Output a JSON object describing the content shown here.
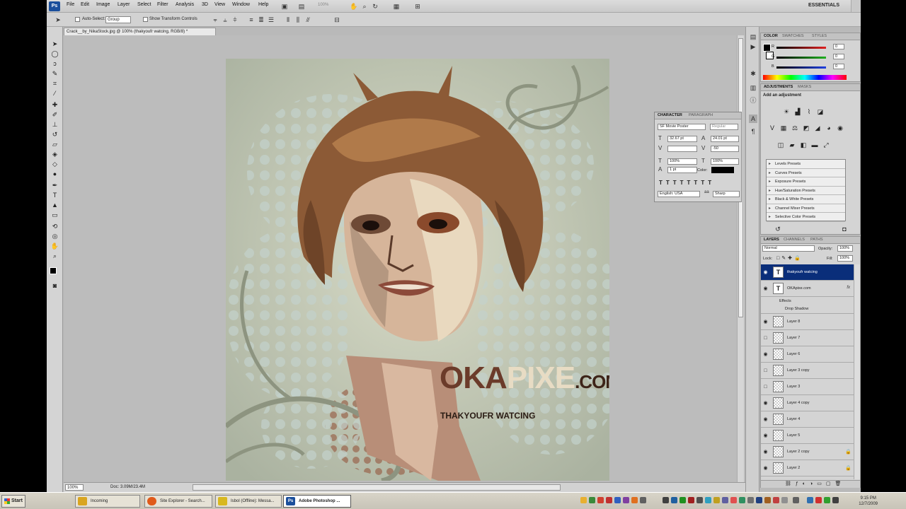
{
  "app": {
    "logo": "Ps",
    "menu": [
      "File",
      "Edit",
      "Image",
      "Layer",
      "Select",
      "Filter",
      "Analysis",
      "3D",
      "View",
      "Window",
      "Help"
    ],
    "zoom_menu": "100%",
    "workspace": "ESSENTIALS"
  },
  "options_bar": {
    "auto_select_label": "Auto-Select:",
    "auto_select_value": "Group",
    "transform_label": "Show Transform Controls"
  },
  "document": {
    "tab_title": "Crack__by_NikaStock.jpg @ 100% (thakyoufr watcing, RGB/8) *",
    "zoom": "100%",
    "doc_size": "Doc: 3.09M/23.4M"
  },
  "artwork": {
    "brand_oka": "OKA",
    "brand_pixe": "PIXE",
    "brand_com": ".COM",
    "tagline": "THAKYOUFR WATCING"
  },
  "color_panel": {
    "tabs": [
      "COLOR",
      "SWATCHES",
      "STYLES"
    ],
    "channels": [
      {
        "label": "R",
        "value": "0",
        "color": "#e02020"
      },
      {
        "label": "G",
        "value": "0",
        "color": "#20b020"
      },
      {
        "label": "B",
        "value": "0",
        "color": "#2040e0"
      }
    ]
  },
  "adjustments_panel": {
    "tabs": [
      "ADJUSTMENTS",
      "MASKS"
    ],
    "title": "Add an adjustment",
    "presets": [
      "Levels Presets",
      "Curves Presets",
      "Exposure Presets",
      "Hue/Saturation Presets",
      "Black & White Presets",
      "Channel Mixer Presets",
      "Selective Color Presets"
    ]
  },
  "character_panel": {
    "tabs": [
      "CHARACTER",
      "PARAGRAPH"
    ],
    "font_family": "SF Movie Poster",
    "font_style": "Regular",
    "font_size": "32.67 pt",
    "leading": "24.01 pt",
    "tracking": "-50",
    "vertical_scale": "100%",
    "horizontal_scale": "100%",
    "baseline_shift": "1 pt",
    "color_label": "Color:",
    "language": "English: USA",
    "antialias": "Sharp"
  },
  "layers_panel": {
    "tabs": [
      "LAYERS",
      "CHANNELS",
      "PATHS"
    ],
    "blend_mode": "Normal",
    "opacity_label": "Opacity:",
    "opacity": "100%",
    "lock_label": "Lock:",
    "fill_label": "Fill:",
    "fill": "100%",
    "effects_label": "Effects",
    "drop_shadow_label": "Drop Shadow",
    "layers": [
      {
        "name": "thakyoufr watcing",
        "kind": "text",
        "visible": true,
        "selected": true
      },
      {
        "name": "OKApixe.com",
        "kind": "text",
        "visible": true,
        "fx": "fx"
      },
      {
        "name": "Layer 8",
        "kind": "raster",
        "visible": true
      },
      {
        "name": "Layer 7",
        "kind": "raster",
        "visible": false
      },
      {
        "name": "Layer 6",
        "kind": "raster",
        "visible": true
      },
      {
        "name": "Layer 3 copy",
        "kind": "raster",
        "visible": false
      },
      {
        "name": "Layer 3",
        "kind": "raster",
        "visible": false
      },
      {
        "name": "Layer 4 copy",
        "kind": "raster",
        "visible": true
      },
      {
        "name": "Layer 4",
        "kind": "raster",
        "visible": true
      },
      {
        "name": "Layer 5",
        "kind": "raster",
        "visible": true
      },
      {
        "name": "Layer 2 copy",
        "kind": "raster",
        "visible": true,
        "locked": true
      },
      {
        "name": "Layer 2",
        "kind": "raster",
        "visible": true,
        "locked": true
      }
    ]
  },
  "taskbar": {
    "start": "Start",
    "tasks": [
      {
        "label": "Incoming",
        "color": "#d9a520"
      },
      {
        "label": "Site Explorer - Search...",
        "color": "#e05a1a"
      },
      {
        "label": "Isbol (Offline): Messa...",
        "color": "#d8b820"
      },
      {
        "label": "Adobe Photoshop ...",
        "color": "#1b4f9c",
        "active": true
      }
    ],
    "time": "9:15 PM",
    "date": "12/7/2009"
  }
}
